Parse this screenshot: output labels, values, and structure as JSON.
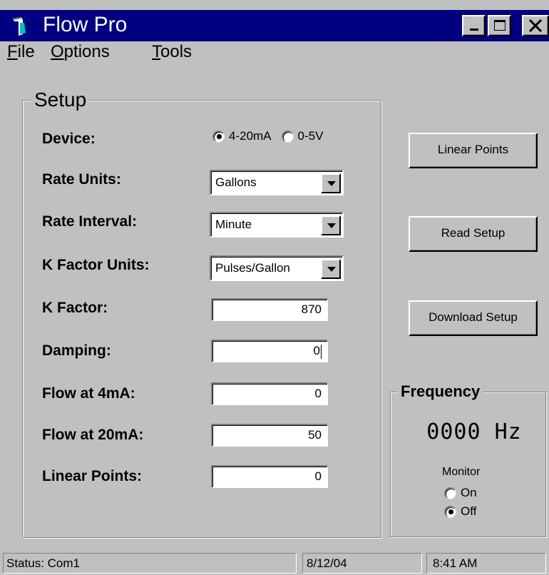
{
  "window": {
    "title": "Flow Pro",
    "title_bar_color": "#000080",
    "face_color": "#c0c0c0",
    "controls": [
      "minimize-icon",
      "maximize-icon",
      "close-icon"
    ]
  },
  "menu": {
    "items": [
      {
        "accel": "F",
        "rest": "ile"
      },
      {
        "accel": "O",
        "rest": "ptions"
      },
      {
        "accel": "T",
        "rest": "ools"
      }
    ]
  },
  "setup": {
    "group_title": "Setup",
    "device": {
      "label": "Device:",
      "options": [
        "4-20mA",
        "0-5V"
      ],
      "selected": "4-20mA"
    },
    "rate_units": {
      "label": "Rate Units:",
      "value": "Gallons"
    },
    "rate_interval": {
      "label": "Rate Interval:",
      "value": "Minute"
    },
    "k_factor_units": {
      "label": "K Factor Units:",
      "value": "Pulses/Gallon"
    },
    "k_factor": {
      "label": "K Factor:",
      "value": "870"
    },
    "damping": {
      "label": "Damping:",
      "value": "0"
    },
    "flow_4ma": {
      "label": "Flow at 4mA:",
      "value": "0"
    },
    "flow_20ma": {
      "label": "Flow at 20mA:",
      "value": "50"
    },
    "linear_points": {
      "label": "Linear Points:",
      "value": "0"
    }
  },
  "buttons": {
    "linear_points": "Linear Points",
    "read_setup": "Read Setup",
    "download_setup": "Download Setup"
  },
  "frequency": {
    "group_title": "Frequency",
    "display": "0000 Hz",
    "monitor_label": "Monitor",
    "options": [
      "On",
      "Off"
    ],
    "selected": "Off"
  },
  "status": {
    "status_text": "Status:  Com1",
    "date": "8/12/04",
    "time": "8:41 AM"
  }
}
